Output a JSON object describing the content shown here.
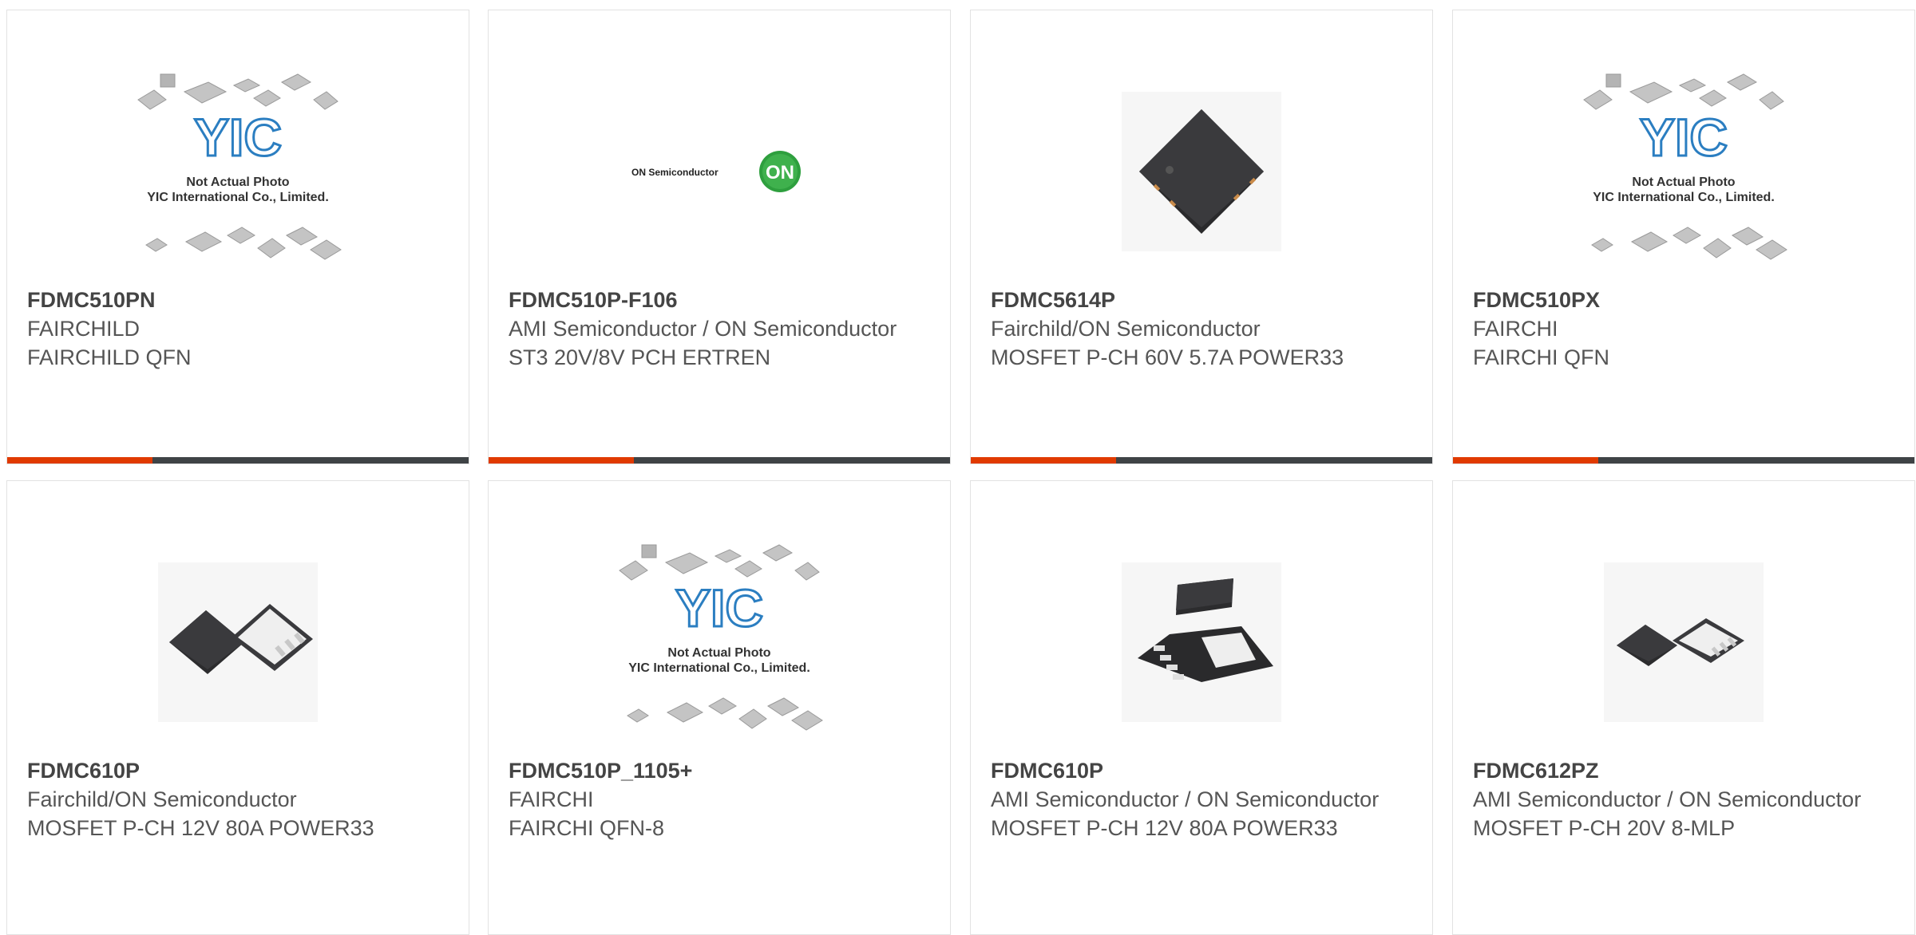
{
  "colors": {
    "accent": "#e03a00",
    "bar": "#3f4346",
    "border": "#e2e2e2",
    "text": "#555555",
    "yic_blue": "#2b7ec1",
    "on_green": "#2e9f3e"
  },
  "products": [
    {
      "part_number": "FDMC510PN",
      "manufacturer": "FAIRCHILD",
      "description": "FAIRCHILD QFN",
      "image": "yic-placeholder-icon",
      "image_caption_1": "Not Actual Photo",
      "image_caption_2": "YIC International Co., Limited."
    },
    {
      "part_number": "FDMC510P-F106",
      "manufacturer": "AMI Semiconductor / ON Semiconductor",
      "description": "ST3 20V/8V PCH ERTREN",
      "image": "on-semiconductor-logo-icon",
      "logo_text": "ON Semiconductor",
      "logo_badge": "ON"
    },
    {
      "part_number": "FDMC5614P",
      "manufacturer": "Fairchild/ON Semiconductor",
      "description": "MOSFET P-CH 60V 5.7A POWER33",
      "image": "qfn-chip-icon"
    },
    {
      "part_number": "FDMC510PX",
      "manufacturer": "FAIRCHI",
      "description": "FAIRCHI QFN",
      "image": "yic-placeholder-icon",
      "image_caption_1": "Not Actual Photo",
      "image_caption_2": "YIC International Co., Limited."
    },
    {
      "part_number": "FDMC610P",
      "manufacturer": "Fairchild/ON Semiconductor",
      "description": "MOSFET P-CH 12V 80A POWER33",
      "image": "qfn-pair-chip-icon"
    },
    {
      "part_number": "FDMC510P_1105+",
      "manufacturer": "FAIRCHI",
      "description": "FAIRCHI QFN-8",
      "image": "yic-placeholder-icon",
      "image_caption_1": "Not Actual Photo",
      "image_caption_2": "YIC International Co., Limited."
    },
    {
      "part_number": "FDMC610P",
      "manufacturer": "AMI Semiconductor / ON Semiconductor",
      "description": "MOSFET P-CH 12V 80A POWER33",
      "image": "qfn-top-bottom-chip-icon"
    },
    {
      "part_number": "FDMC612PZ",
      "manufacturer": "AMI Semiconductor / ON Semiconductor",
      "description": "MOSFET P-CH 20V 8-MLP",
      "image": "qfn-pair-small-chip-icon"
    }
  ]
}
